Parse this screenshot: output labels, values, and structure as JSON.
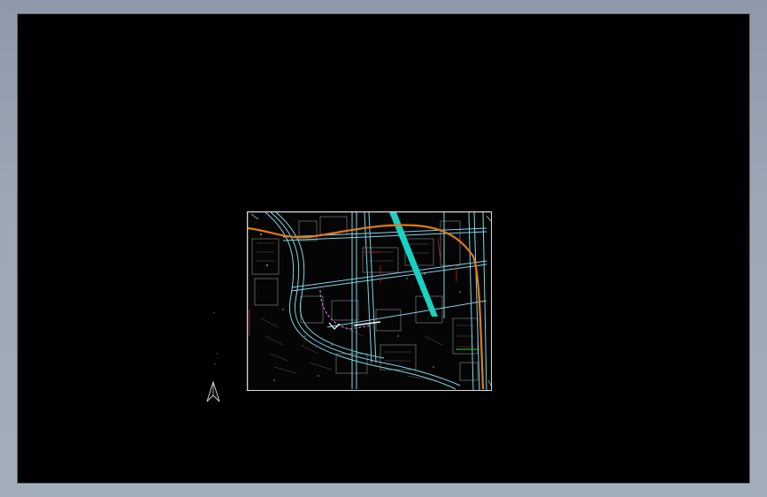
{
  "app": {
    "viewport_background": "#000000",
    "window_background": "#9aa6b4"
  },
  "drawing": {
    "colors": {
      "road_outline": "#7fd4e6",
      "highway": "#e07a1a",
      "green_belt": "#18d2c4",
      "building": "#9a9a9a",
      "red_line": "#c81e1e",
      "route_highlight": "#c06be0"
    },
    "icons": [
      "north-arrow-icon"
    ]
  }
}
